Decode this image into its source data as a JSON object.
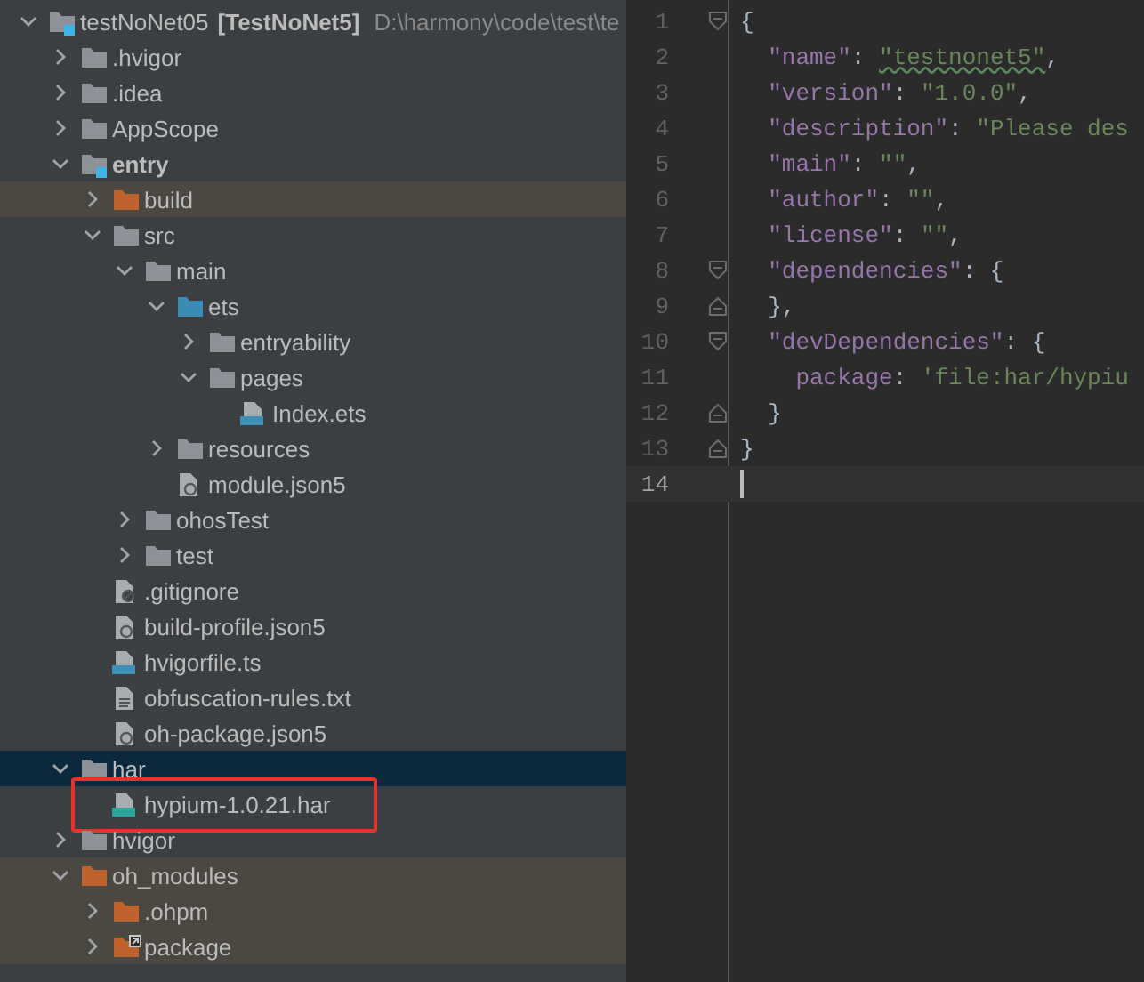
{
  "project_tree": {
    "items": [
      {
        "name": "testNoNet05",
        "module_name": "[TestNoNet5]",
        "path": "D:\\harmony\\code\\test\\te",
        "kind": "module",
        "expanded": true,
        "excluded": false,
        "selected": false,
        "boxed": false,
        "children": [
          {
            "name": ".hvigor",
            "kind": "folder",
            "expanded": false,
            "excluded": false,
            "selected": false,
            "boxed": false
          },
          {
            "name": ".idea",
            "kind": "folder",
            "expanded": false,
            "excluded": false,
            "selected": false,
            "boxed": false
          },
          {
            "name": "AppScope",
            "kind": "folder",
            "expanded": false,
            "excluded": false,
            "selected": false,
            "boxed": false
          },
          {
            "name": "entry",
            "kind": "module",
            "expanded": true,
            "excluded": false,
            "selected": false,
            "boxed": false,
            "children": [
              {
                "name": "build",
                "kind": "folder",
                "expanded": false,
                "excluded": true,
                "selected": false,
                "boxed": false
              },
              {
                "name": "src",
                "kind": "folder",
                "expanded": true,
                "excluded": false,
                "selected": false,
                "boxed": false,
                "children": [
                  {
                    "name": "main",
                    "kind": "folder",
                    "expanded": true,
                    "excluded": false,
                    "selected": false,
                    "boxed": false,
                    "children": [
                      {
                        "name": "ets",
                        "kind": "source",
                        "expanded": true,
                        "excluded": false,
                        "selected": false,
                        "boxed": false,
                        "children": [
                          {
                            "name": "entryability",
                            "kind": "folder",
                            "expanded": false,
                            "excluded": false,
                            "selected": false,
                            "boxed": false
                          },
                          {
                            "name": "pages",
                            "kind": "folder",
                            "expanded": true,
                            "excluded": false,
                            "selected": false,
                            "boxed": false,
                            "children": [
                              {
                                "name": "Index.ets",
                                "kind": "ets",
                                "excluded": false,
                                "selected": false,
                                "boxed": false
                              }
                            ]
                          }
                        ]
                      },
                      {
                        "name": "resources",
                        "kind": "folder",
                        "expanded": false,
                        "excluded": false,
                        "selected": false,
                        "boxed": false
                      },
                      {
                        "name": "module.json5",
                        "kind": "json",
                        "excluded": false,
                        "selected": false,
                        "boxed": false
                      }
                    ]
                  },
                  {
                    "name": "ohosTest",
                    "kind": "folder",
                    "expanded": false,
                    "excluded": false,
                    "selected": false,
                    "boxed": false
                  },
                  {
                    "name": "test",
                    "kind": "folder",
                    "expanded": false,
                    "excluded": false,
                    "selected": false,
                    "boxed": false
                  }
                ]
              },
              {
                "name": ".gitignore",
                "kind": "ignore",
                "excluded": false,
                "selected": false,
                "boxed": false
              },
              {
                "name": "build-profile.json5",
                "kind": "json",
                "excluded": false,
                "selected": false,
                "boxed": false
              },
              {
                "name": "hvigorfile.ts",
                "kind": "ts",
                "excluded": false,
                "selected": false,
                "boxed": false
              },
              {
                "name": "obfuscation-rules.txt",
                "kind": "text",
                "excluded": false,
                "selected": false,
                "boxed": false
              },
              {
                "name": "oh-package.json5",
                "kind": "json",
                "excluded": false,
                "selected": false,
                "boxed": false
              }
            ]
          },
          {
            "name": "har",
            "kind": "folder",
            "expanded": true,
            "excluded": false,
            "selected": true,
            "boxed": false,
            "children": [
              {
                "name": "hypium-1.0.21.har",
                "kind": "har",
                "excluded": false,
                "selected": false,
                "boxed": true
              }
            ]
          },
          {
            "name": "hvigor",
            "kind": "folder",
            "expanded": false,
            "excluded": false,
            "selected": false,
            "boxed": false
          },
          {
            "name": "oh_modules",
            "kind": "folder",
            "expanded": true,
            "excluded": true,
            "selected": false,
            "boxed": false,
            "children": [
              {
                "name": ".ohpm",
                "kind": "folder",
                "expanded": false,
                "excluded": true,
                "selected": false,
                "boxed": false
              },
              {
                "name": "package",
                "kind": "link",
                "expanded": false,
                "excluded": true,
                "selected": false,
                "boxed": false
              }
            ]
          }
        ]
      }
    ]
  },
  "editor": {
    "lines": [
      {
        "number": "1",
        "fold_start": true,
        "fold_end": false,
        "current": false,
        "tokens": [
          {
            "kind": "punct",
            "text": "{"
          }
        ]
      },
      {
        "number": "2",
        "fold_start": false,
        "fold_end": false,
        "current": false,
        "tokens": [
          {
            "kind": "key",
            "text": "  \"name\""
          },
          {
            "kind": "punct",
            "text": ": "
          },
          {
            "kind": "string",
            "text": "\"testnonet5\"",
            "typo": true
          },
          {
            "kind": "punct",
            "text": ","
          }
        ]
      },
      {
        "number": "3",
        "fold_start": false,
        "fold_end": false,
        "current": false,
        "tokens": [
          {
            "kind": "key",
            "text": "  \"version\""
          },
          {
            "kind": "punct",
            "text": ": "
          },
          {
            "kind": "string",
            "text": "\"1.0.0\""
          },
          {
            "kind": "punct",
            "text": ","
          }
        ]
      },
      {
        "number": "4",
        "fold_start": false,
        "fold_end": false,
        "current": false,
        "tokens": [
          {
            "kind": "key",
            "text": "  \"description\""
          },
          {
            "kind": "punct",
            "text": ": "
          },
          {
            "kind": "string",
            "text": "\"Please des"
          }
        ]
      },
      {
        "number": "5",
        "fold_start": false,
        "fold_end": false,
        "current": false,
        "tokens": [
          {
            "kind": "key",
            "text": "  \"main\""
          },
          {
            "kind": "punct",
            "text": ": "
          },
          {
            "kind": "string",
            "text": "\"\""
          },
          {
            "kind": "punct",
            "text": ","
          }
        ]
      },
      {
        "number": "6",
        "fold_start": false,
        "fold_end": false,
        "current": false,
        "tokens": [
          {
            "kind": "key",
            "text": "  \"author\""
          },
          {
            "kind": "punct",
            "text": ": "
          },
          {
            "kind": "string",
            "text": "\"\""
          },
          {
            "kind": "punct",
            "text": ","
          }
        ]
      },
      {
        "number": "7",
        "fold_start": false,
        "fold_end": false,
        "current": false,
        "tokens": [
          {
            "kind": "key",
            "text": "  \"license\""
          },
          {
            "kind": "punct",
            "text": ": "
          },
          {
            "kind": "string",
            "text": "\"\""
          },
          {
            "kind": "punct",
            "text": ","
          }
        ]
      },
      {
        "number": "8",
        "fold_start": true,
        "fold_end": false,
        "current": false,
        "tokens": [
          {
            "kind": "key",
            "text": "  \"dependencies\""
          },
          {
            "kind": "punct",
            "text": ": {"
          }
        ]
      },
      {
        "number": "9",
        "fold_start": false,
        "fold_end": true,
        "current": false,
        "tokens": [
          {
            "kind": "punct",
            "text": "  },"
          }
        ]
      },
      {
        "number": "10",
        "fold_start": true,
        "fold_end": false,
        "current": false,
        "tokens": [
          {
            "kind": "key",
            "text": "  \"devDependencies\""
          },
          {
            "kind": "punct",
            "text": ": {"
          }
        ]
      },
      {
        "number": "11",
        "fold_start": false,
        "fold_end": false,
        "current": false,
        "tokens": [
          {
            "kind": "key",
            "text": "    package"
          },
          {
            "kind": "punct",
            "text": ": "
          },
          {
            "kind": "string",
            "text": "'file:har/hypiu"
          }
        ]
      },
      {
        "number": "12",
        "fold_start": false,
        "fold_end": true,
        "current": false,
        "tokens": [
          {
            "kind": "punct",
            "text": "  }"
          }
        ]
      },
      {
        "number": "13",
        "fold_start": false,
        "fold_end": true,
        "current": false,
        "tokens": [
          {
            "kind": "punct",
            "text": "}"
          }
        ]
      },
      {
        "number": "14",
        "fold_start": false,
        "fold_end": false,
        "current": true
      }
    ]
  }
}
